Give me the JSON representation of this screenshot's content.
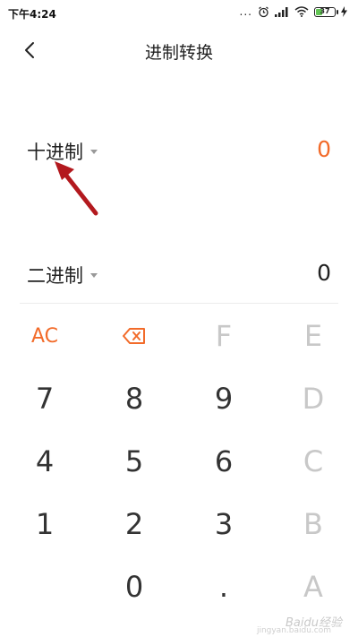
{
  "status_bar": {
    "time": "下午4:24",
    "dots": "...",
    "battery_level": "37"
  },
  "header": {
    "title": "进制转换"
  },
  "rows": [
    {
      "label": "十进制",
      "value": "0"
    },
    {
      "label": "二进制",
      "value": "0"
    }
  ],
  "keypad": {
    "row1": [
      "AC",
      "",
      "F",
      "E"
    ],
    "row2": [
      "7",
      "8",
      "9",
      "D"
    ],
    "row3": [
      "4",
      "5",
      "6",
      "C"
    ],
    "row4": [
      "1",
      "2",
      "3",
      "B"
    ],
    "row5": [
      "",
      "0",
      ".",
      "A"
    ]
  },
  "watermark": {
    "brand": "Baidu经验",
    "url": "jingyan.baidu.com"
  },
  "colors": {
    "accent": "#f26b2a",
    "disabled": "#c8c8c8",
    "battery": "#62c554",
    "annotation_arrow": "#b3191e"
  }
}
